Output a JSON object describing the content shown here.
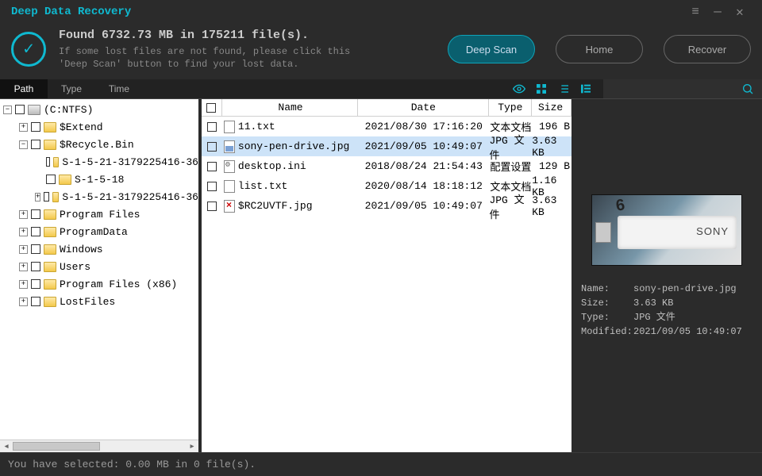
{
  "app": {
    "title": "Deep Data Recovery"
  },
  "header": {
    "found": "Found 6732.73 MB in 175211 file(s).",
    "hint1": "If some lost files are not found, please click this",
    "hint2": "'Deep Scan' button to find your lost data.",
    "deep_scan": "Deep Scan",
    "home": "Home",
    "recover": "Recover"
  },
  "tabs": {
    "path": "Path",
    "type": "Type",
    "time": "Time"
  },
  "tree": {
    "root": "(C:NTFS)",
    "items": [
      "$Extend",
      "$Recycle.Bin",
      "Program Files",
      "ProgramData",
      "Windows",
      "Users",
      "Program Files (x86)",
      "LostFiles"
    ],
    "recycle_children": [
      "S-1-5-21-3179225416-36",
      "S-1-5-18",
      "S-1-5-21-3179225416-36"
    ]
  },
  "cols": {
    "name": "Name",
    "date": "Date",
    "type": "Type",
    "size": "Size"
  },
  "files": [
    {
      "name": "11.txt",
      "date": "2021/08/30 17:16:20",
      "type": "文本文档",
      "size": "196  B",
      "icon": "txt"
    },
    {
      "name": "sony-pen-drive.jpg",
      "date": "2021/09/05 10:49:07",
      "type": "JPG 文件",
      "size": "3.63 KB",
      "icon": "img",
      "selected": true
    },
    {
      "name": "desktop.ini",
      "date": "2018/08/24 21:54:43",
      "type": "配置设置",
      "size": "129  B",
      "icon": "cfg"
    },
    {
      "name": "list.txt",
      "date": "2020/08/14 18:18:12",
      "type": "文本文档",
      "size": "1.16 KB",
      "icon": "txt"
    },
    {
      "name": "$RC2UVTF.jpg",
      "date": "2021/09/05 10:49:07",
      "type": "JPG 文件",
      "size": "3.63 KB",
      "icon": "bad"
    }
  ],
  "details": {
    "name_k": "Name:",
    "name_v": "sony-pen-drive.jpg",
    "size_k": "Size:",
    "size_v": "3.63 KB",
    "type_k": "Type:",
    "type_v": "JPG 文件",
    "mod_k": "Modified:",
    "mod_v": "2021/09/05 10:49:07"
  },
  "status": "You have selected: 0.00 MB in 0 file(s)."
}
